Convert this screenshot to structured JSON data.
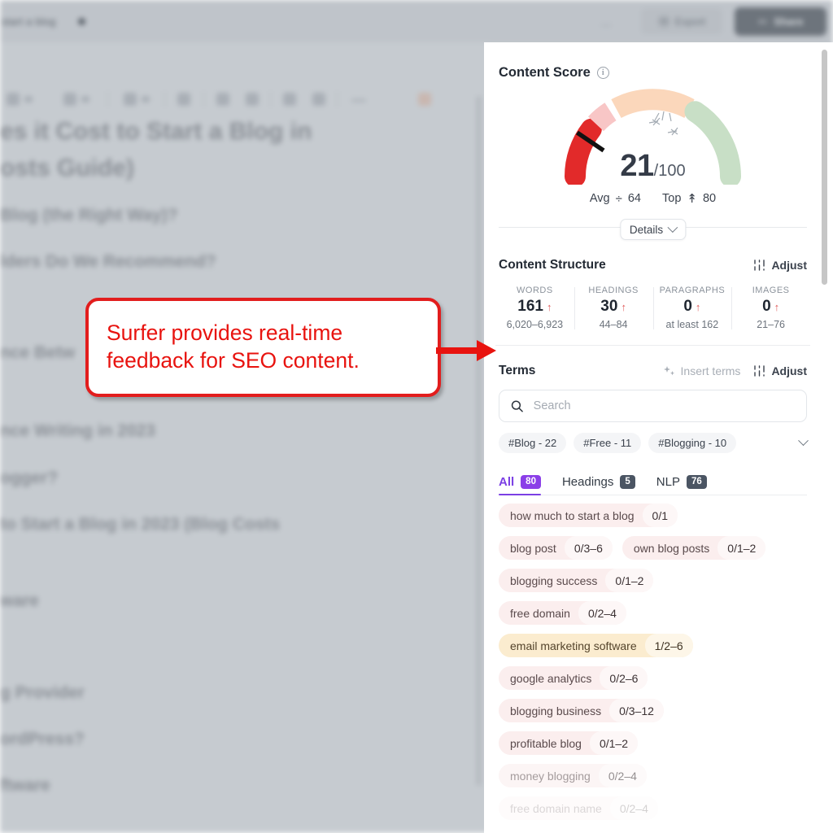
{
  "topbar": {
    "doc_title": "start a blog",
    "more_label": "…",
    "export_label": "Export",
    "export_icon": "wordpress-icon",
    "share_label": "Share",
    "share_icon": "share-icon"
  },
  "editor": {
    "lines": [
      "es it Cost to Start a Blog in",
      "osts Guide)",
      "Blog (the Right Way)?",
      "lders Do We Recommend?",
      "nce Betw",
      "nce Writing in 2023",
      "ogger?",
      " to Start a Blog in 2023 (Blog Costs",
      "ware",
      "g Provider",
      "ordPress?",
      "ftware"
    ]
  },
  "callout": {
    "text": "Surfer provides real-time feedback for SEO content.",
    "color": "#e8130f"
  },
  "panel": {
    "content_score": {
      "title": "Content Score",
      "info_icon": "info-icon",
      "score": "21",
      "score_suffix": "/100",
      "avg_label": "Avg",
      "avg_icon": "divide-icon",
      "avg_value": "64",
      "top_label": "Top",
      "top_icon": "up-arrow-to-line-icon",
      "top_value": "80",
      "details_label": "Details",
      "gauge": {
        "value": 21,
        "max": 100,
        "segments": [
          {
            "from": 0,
            "to": 21,
            "color": "#e22a2a"
          },
          {
            "from": 21,
            "to": 34,
            "color": "#f8c6c6"
          },
          {
            "from": 34,
            "to": 66,
            "color": "#fbd7bb"
          },
          {
            "from": 66,
            "to": 100,
            "color": "#c8dfc6"
          }
        ],
        "needle_color": "#111111"
      }
    },
    "content_structure": {
      "title": "Content Structure",
      "adjust_label": "Adjust",
      "adjust_icon": "sliders-icon",
      "metrics": [
        {
          "label": "WORDS",
          "value": "161",
          "trend": "up",
          "range": "6,020–6,923"
        },
        {
          "label": "HEADINGS",
          "value": "30",
          "trend": "up",
          "range": "44–84"
        },
        {
          "label": "PARAGRAPHS",
          "value": "0",
          "trend": "up",
          "range": "at least 162"
        },
        {
          "label": "IMAGES",
          "value": "0",
          "trend": "up",
          "range": "21–76"
        }
      ]
    },
    "terms": {
      "title": "Terms",
      "insert_terms_label": "Insert terms",
      "insert_terms_icon": "sparkles-icon",
      "adjust_label": "Adjust",
      "adjust_icon": "sliders-icon",
      "search_placeholder": "Search",
      "search_value": "",
      "search_icon": "search-icon",
      "tags": [
        "#Blog - 22",
        "#Free - 11",
        "#Blogging - 10"
      ],
      "tags_expand_icon": "chevron-down-icon",
      "tabs": [
        {
          "label": "All",
          "badge": "80",
          "active": true
        },
        {
          "label": "Headings",
          "badge": "5",
          "active": false
        },
        {
          "label": "NLP",
          "badge": "76",
          "active": false
        }
      ],
      "rows": [
        [
          {
            "term": "how much to start a blog",
            "count": "0/1",
            "state": "normal"
          }
        ],
        [
          {
            "term": "blog post",
            "count": "0/3–6",
            "state": "normal"
          },
          {
            "term": "own blog posts",
            "count": "0/1–2",
            "state": "normal"
          }
        ],
        [
          {
            "term": "blogging success",
            "count": "0/1–2",
            "state": "normal"
          }
        ],
        [
          {
            "term": "free domain",
            "count": "0/2–4",
            "state": "normal"
          }
        ],
        [
          {
            "term": "email marketing software",
            "count": "1/2–6",
            "state": "warm"
          }
        ],
        [
          {
            "term": "google analytics",
            "count": "0/2–6",
            "state": "normal"
          }
        ],
        [
          {
            "term": "blogging business",
            "count": "0/3–12",
            "state": "normal"
          }
        ],
        [
          {
            "term": "profitable blog",
            "count": "0/1–2",
            "state": "normal"
          }
        ],
        [
          {
            "term": "money blogging",
            "count": "0/2–4",
            "state": "fade1"
          }
        ],
        [
          {
            "term": "free domain name",
            "count": "0/2–4",
            "state": "fade2"
          }
        ]
      ]
    }
  },
  "colors": {
    "accent_purple": "#7b3fe4",
    "score_red": "#e22a2a",
    "callout_red": "#e21d1d",
    "panel_bg": "#ffffff",
    "editor_bg": "#c6cbd0"
  }
}
